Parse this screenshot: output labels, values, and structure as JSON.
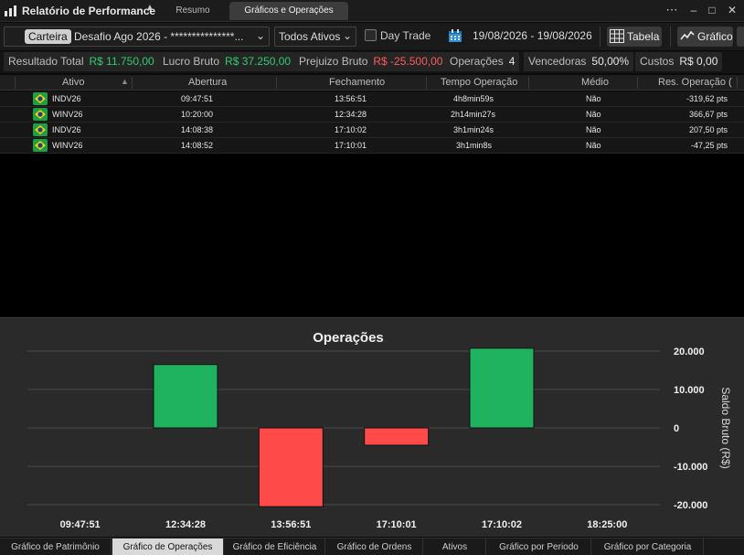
{
  "window": {
    "title": "Relatório de Performance",
    "tabs": [
      {
        "label": "Resumo",
        "active": false
      },
      {
        "label": "Gráficos e Operações",
        "active": true
      }
    ]
  },
  "toolbar": {
    "portfolio_label": "Carteira",
    "portfolio_value": "Desafio Ago 2026 - ***************...",
    "assets_value": "Todos Ativos",
    "day_trade_label": "Day Trade",
    "day_trade_checked": false,
    "date_range": "19/08/2026 - 19/08/2026",
    "table_label": "Tabela",
    "chart_label": "Gráfico"
  },
  "stats": {
    "resultado_total": {
      "label": "Resultado Total",
      "value": "R$ 11.750,00"
    },
    "lucro_bruto": {
      "label": "Lucro Bruto",
      "value": "R$ 37.250,00"
    },
    "prejuizo_bruto": {
      "label": "Prejuizo Bruto",
      "value": "R$ -25.500,00"
    },
    "operacoes": {
      "label": "Operações",
      "value": "4"
    },
    "vencedoras": {
      "label": "Vencedoras",
      "value": "50,00%"
    },
    "custos": {
      "label": "Custos",
      "value": "R$ 0,00"
    }
  },
  "table": {
    "columns": [
      "Ativo",
      "Abertura",
      "Fechamento",
      "Tempo Operação",
      "Médio",
      "Res. Operação ("
    ],
    "rows": [
      {
        "ativo": "INDV26",
        "abertura": "09:47:51",
        "fechamento": "13:56:51",
        "tempo": "4h8min59s",
        "medio": "Não",
        "resultado": "-319,62 pts",
        "positive": false
      },
      {
        "ativo": "WINV26",
        "abertura": "10:20:00",
        "fechamento": "12:34:28",
        "tempo": "2h14min27s",
        "medio": "Não",
        "resultado": "366,67 pts",
        "positive": true
      },
      {
        "ativo": "INDV26",
        "abertura": "14:08:38",
        "fechamento": "17:10:02",
        "tempo": "3h1min24s",
        "medio": "Não",
        "resultado": "207,50 pts",
        "positive": true
      },
      {
        "ativo": "WINV26",
        "abertura": "14:08:52",
        "fechamento": "17:10:01",
        "tempo": "3h1min8s",
        "medio": "Não",
        "resultado": "-47,25 pts",
        "positive": false
      }
    ]
  },
  "chart_data": {
    "type": "bar",
    "title": "Operações",
    "xlabel": "",
    "ylabel": "Saldo Bruto (R$)",
    "x_ticks": [
      "09:47:51",
      "12:34:28",
      "13:56:51",
      "17:10:01",
      "17:10:02",
      "18:25:00"
    ],
    "ylim": [
      -20000,
      20000
    ],
    "y_ticks": [
      20000,
      10000,
      0,
      -10000,
      -20000
    ],
    "y_tick_labels": [
      "20.000",
      "10.000",
      "0",
      "-10.000",
      "-20.000"
    ],
    "bars": [
      {
        "label": "WINV26 12:34:28",
        "value": 16500,
        "color": "#1fb35f"
      },
      {
        "label": "INDV26 13:56:51",
        "value": -20500,
        "color": "#ff4a4a"
      },
      {
        "label": "WINV26 17:10:01",
        "value": -4500,
        "color": "#ff4a4a"
      },
      {
        "label": "INDV26 17:10:02",
        "value": 20750,
        "color": "#1fb35f"
      }
    ],
    "grid": true,
    "y_axis_position": "right"
  },
  "bottom_tabs": [
    {
      "label": "Gráfico de Patrimônio",
      "active": false
    },
    {
      "label": "Gráfico de Operações",
      "active": true
    },
    {
      "label": "Gráfico de Eficiência",
      "active": false
    },
    {
      "label": "Gráfico de Ordens",
      "active": false
    },
    {
      "label": "Ativos",
      "active": false
    },
    {
      "label": "Gráfico por Periodo",
      "active": false
    },
    {
      "label": "Gráfico por Categoria",
      "active": false
    }
  ],
  "colors": {
    "positive": "#2ecc71",
    "negative": "#ff5a5a",
    "bar_positive": "#1fb35f",
    "bar_negative": "#ff4a4a"
  }
}
